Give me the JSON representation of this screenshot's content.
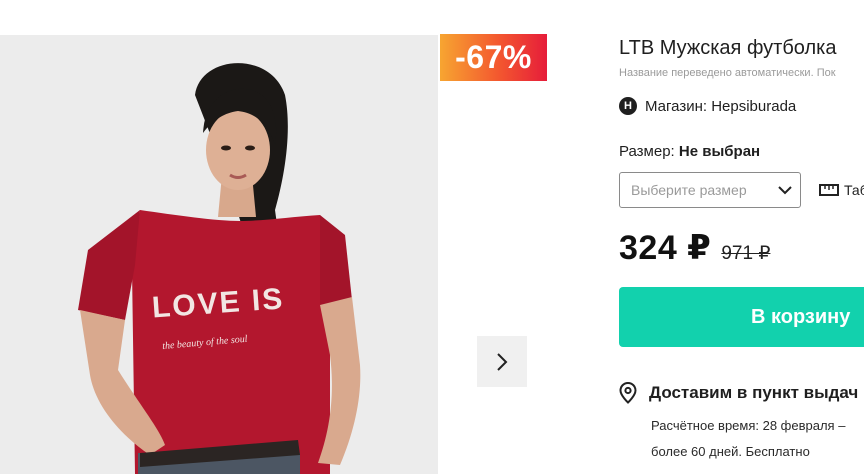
{
  "product": {
    "discount": "-67%",
    "title": "LTB Мужская футболка",
    "translation_note": "Название переведено автоматически. Пок",
    "store_label": "Магазин: Hepsiburada",
    "store_logo_letter": "H",
    "size_label": "Размер:",
    "size_value": "Не выбран",
    "size_placeholder": "Выберите размер",
    "size_table_label": "Таб",
    "price_current": "324 ₽",
    "price_old": "971 ₽",
    "cart_button": "В корзину",
    "shirt_print_line1": "LOVE IS",
    "shirt_print_line2": "the beauty of the soul"
  },
  "delivery": {
    "title": "Доставим в пункт выдач",
    "line1": "Расчётное время: 28 февраля –",
    "line2": "более 60 дней. Бесплатно"
  },
  "icons": {
    "next": "chevron-right-icon",
    "dropdown": "chevron-down-icon",
    "ruler": "ruler-icon",
    "location": "location-pin-icon"
  },
  "colors": {
    "accent": "#12d1ad",
    "badge_start": "#f7a531",
    "badge_end": "#e61d3a",
    "shirt": "#b3172e"
  }
}
